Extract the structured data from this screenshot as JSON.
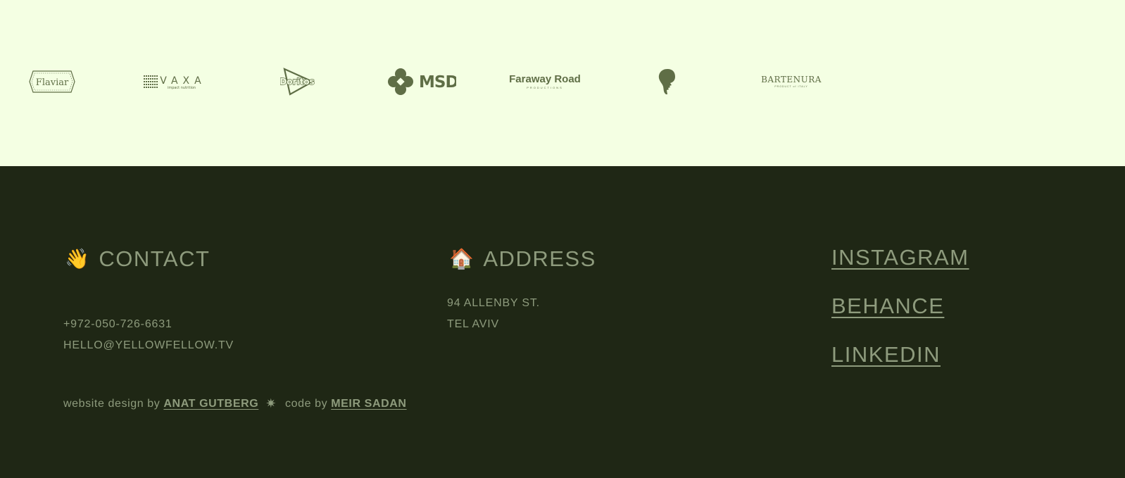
{
  "logos": [
    {
      "name": "Flaviar",
      "text": "Flaviar"
    },
    {
      "name": "VAXA",
      "text": "VAXA",
      "subtext": "impact nutrition"
    },
    {
      "name": "Doritos",
      "text": "Doritos"
    },
    {
      "name": "MSD",
      "text": "MSD"
    },
    {
      "name": "Faraway Road",
      "text": "Faraway Road",
      "subtext": "PRODUCTIONS"
    },
    {
      "name": "head-silhouette",
      "text": ""
    },
    {
      "name": "Bartenura",
      "text": "BARTENURA",
      "subtext": "PRODUCT of ITALY"
    }
  ],
  "contact": {
    "emoji": "👋",
    "heading": "CONTACT",
    "phone": "+972-050-726-6631",
    "email": "HELLO@YELLOWFELLOW.TV"
  },
  "address": {
    "emoji": "🏠",
    "heading": "ADDRESS",
    "line1": "94 ALLENBY ST.",
    "line2": "TEL AVIV"
  },
  "social": {
    "instagram": "INSTAGRAM",
    "behance": "BEHANCE",
    "linkedin": "LINKEDIN"
  },
  "credits": {
    "design_prefix": "website design by",
    "designer": "ANAT GUTBERG",
    "separator": "✷",
    "code_prefix": "code by",
    "developer": "MEIR SADAN"
  },
  "colors": {
    "band_background": "#f4ffe3",
    "footer_background": "#1f2715",
    "logo_color": "#5f6e46",
    "text_color": "#8e9b7d"
  }
}
